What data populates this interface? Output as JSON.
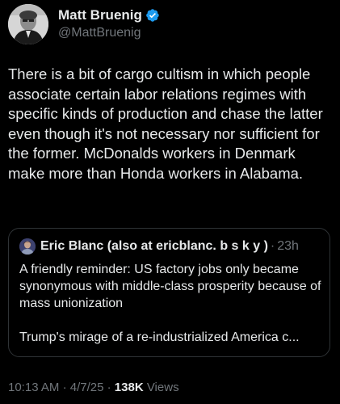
{
  "author": {
    "display_name": "Matt Bruenig",
    "handle": "@MattBruenig",
    "verified_icon": "verified-badge-icon",
    "verified_color": "#1d9bf0"
  },
  "post": {
    "text": "There is a bit of cargo cultism in which people associate certain labor relations regimes with specific kinds of production and chase the latter even though it's not necessary nor sufficient for the former. McDonalds workers in Denmark make more than Honda workers in Alabama."
  },
  "quoted_post": {
    "display_name": "Eric Blanc (also at ericblanc. b s k y )",
    "separator": "·",
    "time": "23h",
    "paragraph_1": "A friendly reminder: US factory jobs only became synonymous with middle-class prosperity because of mass unionization",
    "paragraph_2": "Trump's mirage of a re-industrialized America c..."
  },
  "meta": {
    "time": "10:13 AM",
    "sep1": "·",
    "date": "4/7/25",
    "sep2": "·",
    "views_count": "138K",
    "views_label": "Views"
  },
  "colors": {
    "background": "#000000",
    "text_primary": "#e7e9ea",
    "text_secondary": "#71767b",
    "border": "#2f3336",
    "accent": "#1d9bf0"
  }
}
